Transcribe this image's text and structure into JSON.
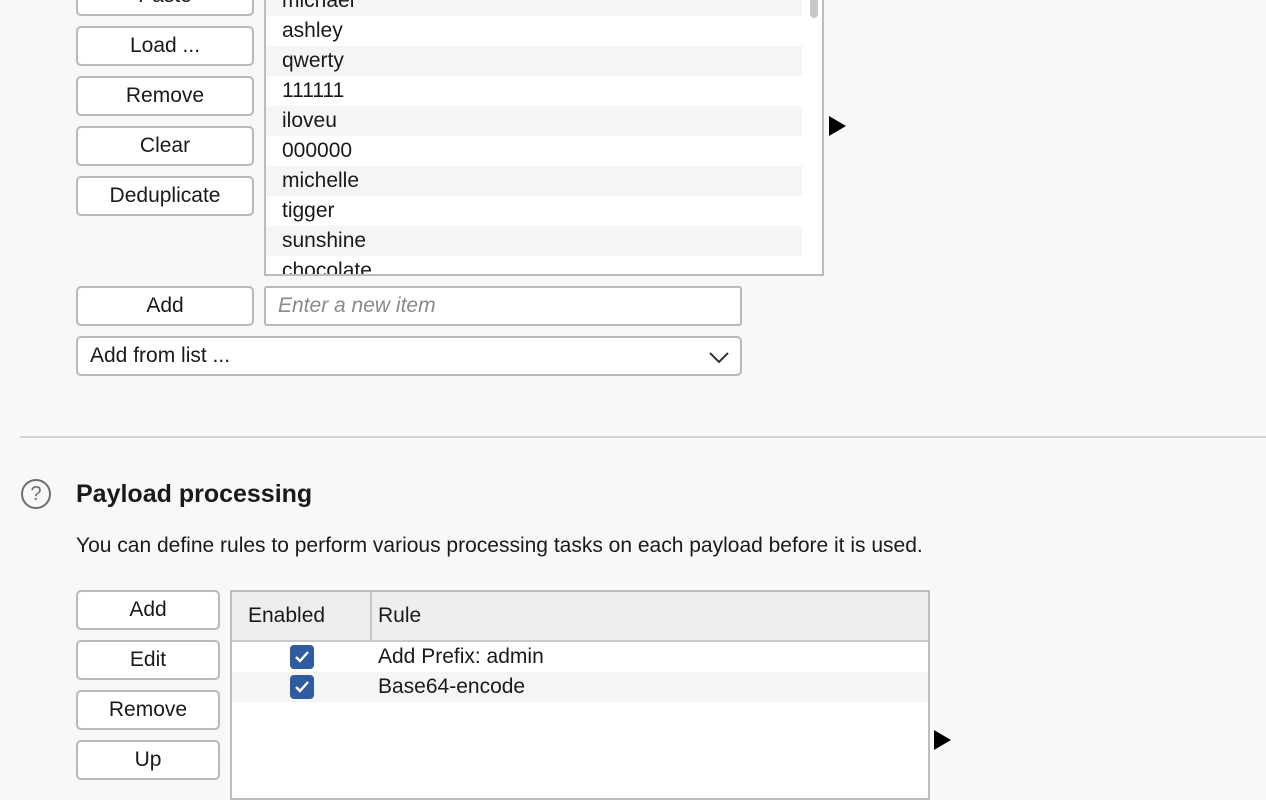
{
  "payload_list": {
    "buttons": {
      "paste": "Paste",
      "load": "Load ...",
      "remove": "Remove",
      "clear": "Clear",
      "deduplicate": "Deduplicate",
      "add": "Add"
    },
    "items": [
      "michael",
      "ashley",
      "qwerty",
      "111111",
      "iloveu",
      "000000",
      "michelle",
      "tigger",
      "sunshine",
      "chocolate"
    ],
    "new_item_placeholder": "Enter a new item",
    "new_item_value": "",
    "add_from_list": "Add from list ..."
  },
  "payload_processing": {
    "title": "Payload processing",
    "description": "You can define rules to perform various processing tasks on each payload before it is used.",
    "buttons": {
      "add": "Add",
      "edit": "Edit",
      "remove": "Remove",
      "up": "Up"
    },
    "table": {
      "columns": [
        "Enabled",
        "Rule"
      ],
      "rows": [
        {
          "enabled": true,
          "rule": "Add Prefix: admin"
        },
        {
          "enabled": true,
          "rule": "Base64-encode"
        }
      ]
    }
  },
  "icons": {
    "help": "help-circle-icon",
    "expand_arrow": "triangle-right-icon",
    "dropdown": "chevron-down-icon",
    "checkbox": "checkmark-icon"
  },
  "colors": {
    "background": "#f8f8f8",
    "checkbox": "#2f5c9e",
    "border": "#b9b9b9"
  }
}
